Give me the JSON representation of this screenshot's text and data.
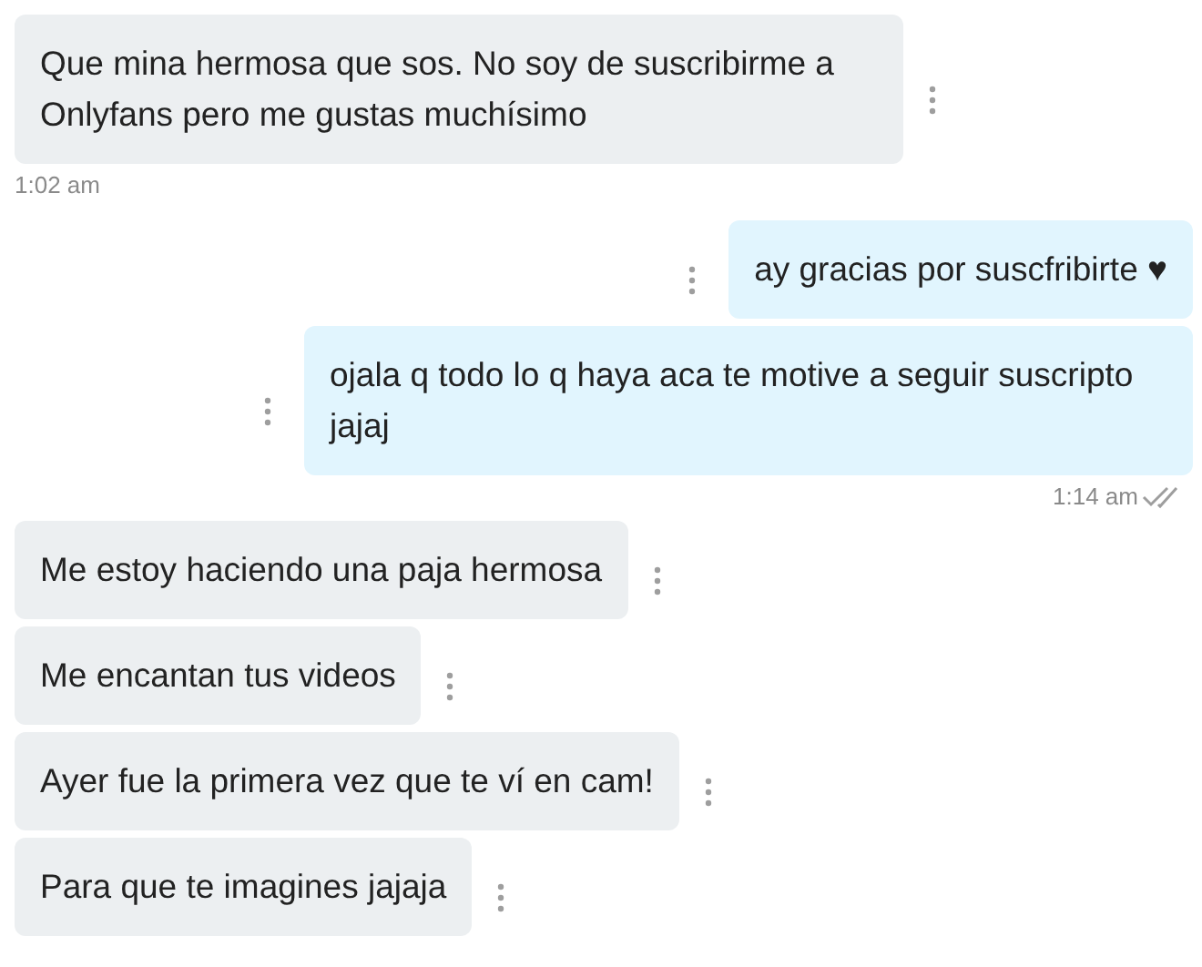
{
  "messages": [
    {
      "kind": "incoming",
      "text": "Que mina hermosa que sos. No soy de suscribirme a Onlyfans pero me gustas muchísimo"
    },
    {
      "kind": "time_left",
      "text": "1:02 am"
    },
    {
      "kind": "outgoing",
      "text": "ay gracias por suscfribirte ♥"
    },
    {
      "kind": "outgoing",
      "text": "ojala q todo lo q haya aca te motive a seguir suscripto jajaj"
    },
    {
      "kind": "time_right",
      "text": "1:14 am",
      "read": true
    },
    {
      "kind": "incoming",
      "text": "Me estoy haciendo una paja hermosa"
    },
    {
      "kind": "incoming",
      "text": "Me encantan tus videos"
    },
    {
      "kind": "incoming",
      "text": "Ayer fue la primera vez que te ví en cam!"
    },
    {
      "kind": "incoming",
      "text": "Para que te imagines jajaja"
    }
  ]
}
